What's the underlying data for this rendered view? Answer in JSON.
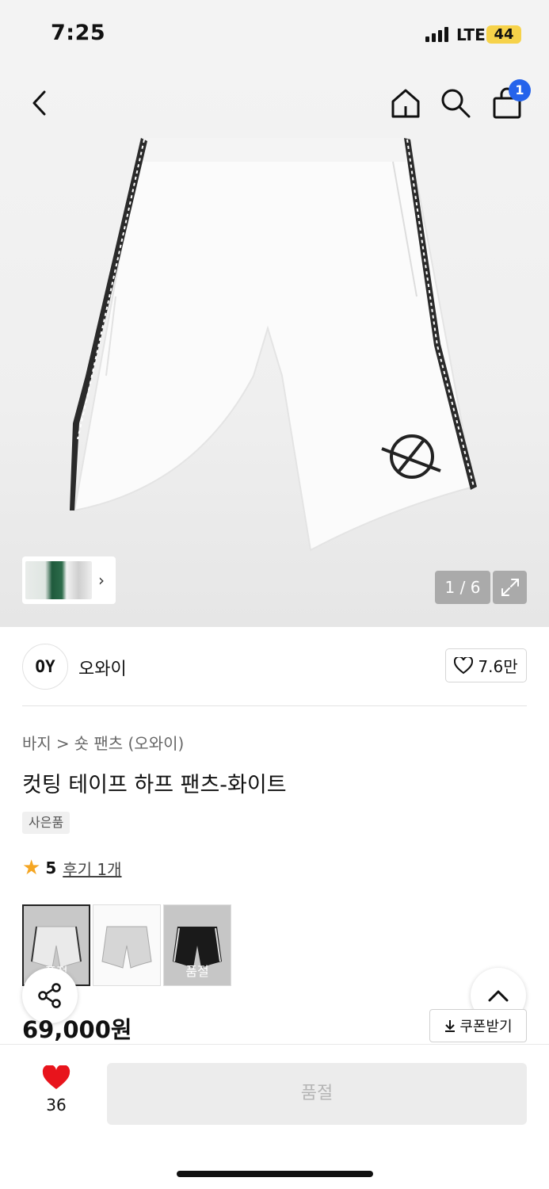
{
  "status_bar": {
    "time": "7:25",
    "network": "LTE",
    "battery": "44"
  },
  "header": {
    "cart_count": "1"
  },
  "gallery": {
    "counter": "1 / 6"
  },
  "brand": {
    "logo_text": "OY",
    "name": "오와이",
    "likes": "7.6만"
  },
  "breadcrumb": {
    "category": "바지",
    "separator": ">",
    "subcategory": "숏 팬츠 (오와이)"
  },
  "product": {
    "title": "컷팅 테이프 하프 팬츠-화이트",
    "tag": "사은품",
    "rating": "5",
    "reviews": "후기 1개",
    "price": "69,000원"
  },
  "options": [
    {
      "label": "품절",
      "color": "#c8c8c8"
    },
    {
      "label": "",
      "color": "#fafafa"
    },
    {
      "label": "품절",
      "color": "#c6c6c6"
    }
  ],
  "coupon": {
    "label": "쿠폰받기"
  },
  "bottom": {
    "wish_count": "36",
    "buy_label": "품절"
  },
  "colors": {
    "accent": "#2563eb",
    "heart": "#e8141c",
    "star": "#f5a623",
    "battery": "#f6d24a"
  },
  "icons": [
    "back-icon",
    "home-icon",
    "search-icon",
    "cart-icon",
    "expand-icon",
    "heart-outline-icon",
    "star-icon",
    "share-icon",
    "chevron-up-icon",
    "download-icon",
    "heart-filled-icon"
  ]
}
